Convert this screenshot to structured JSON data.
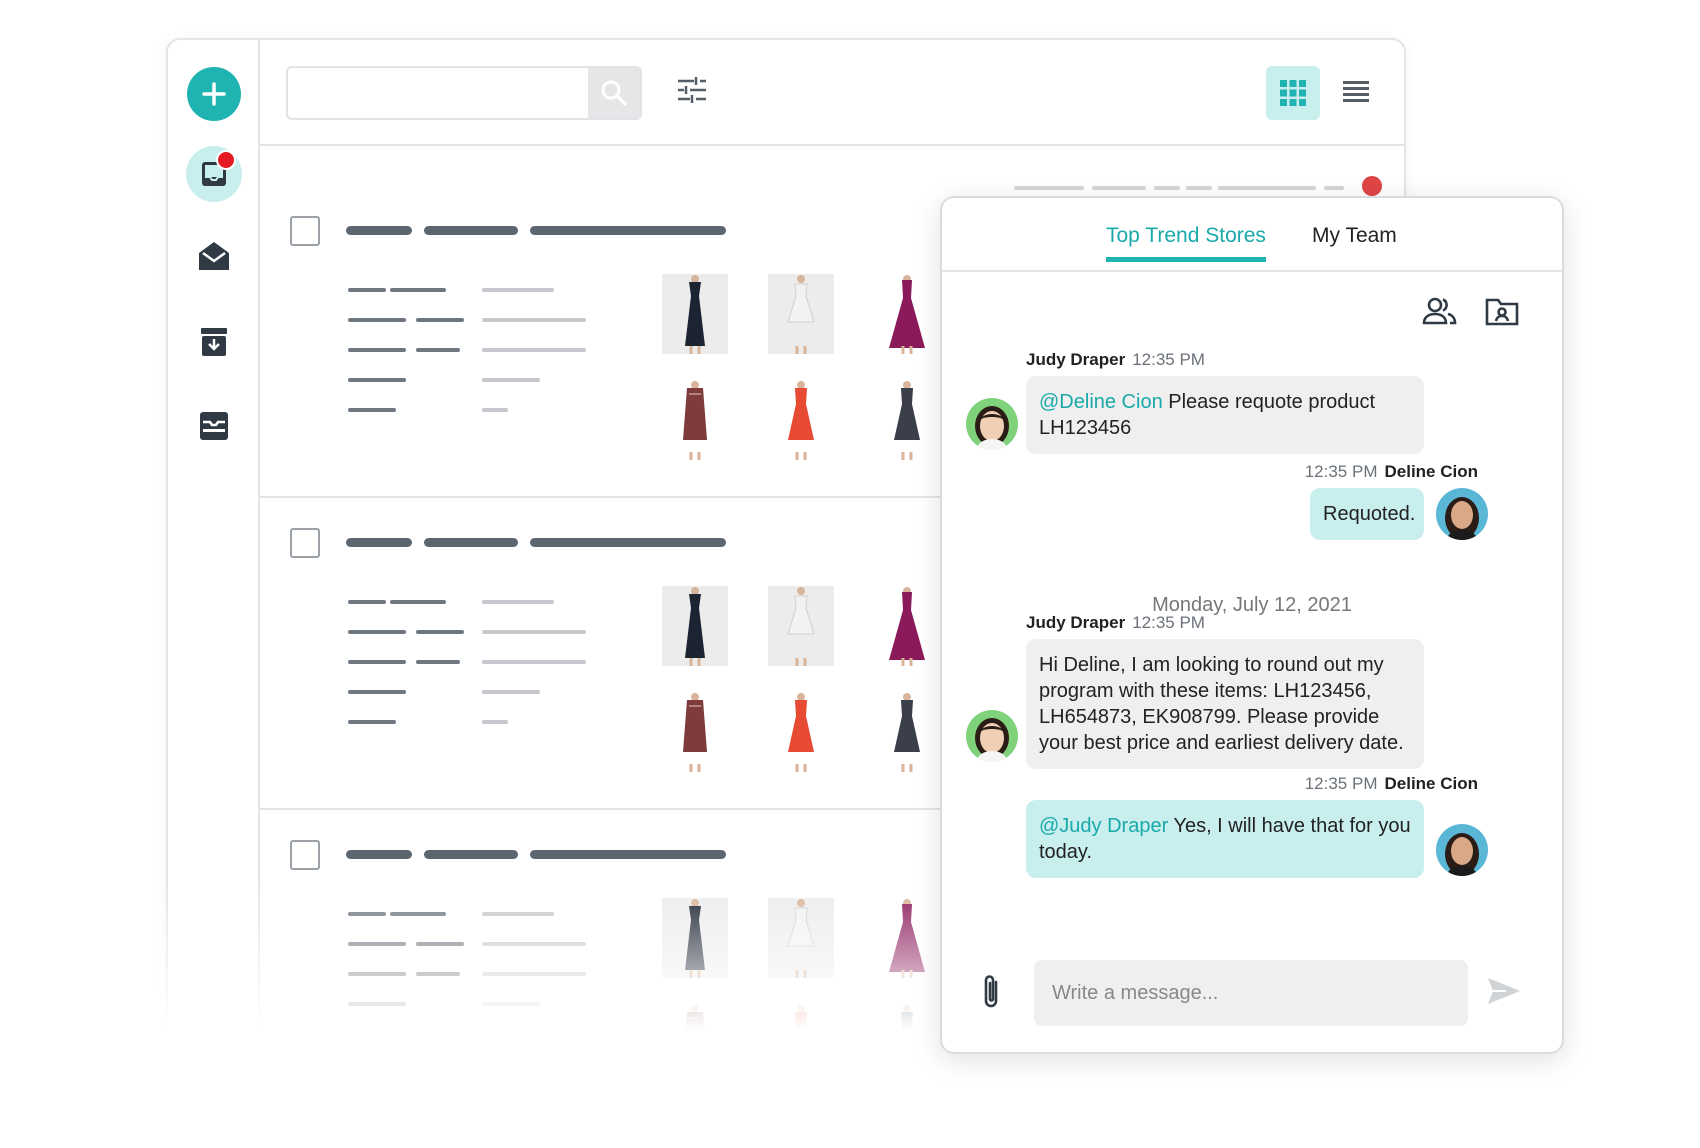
{
  "search": {
    "placeholder": ""
  },
  "colors": {
    "accent": "#1fb3b1",
    "accent_light": "#c9eeee",
    "notification": "#e31b23",
    "bar": "#5c6670"
  },
  "rail": {
    "items": [
      {
        "icon": "add-icon"
      },
      {
        "icon": "inbox-icon",
        "active": true,
        "has_notification": true
      },
      {
        "icon": "open-mail-icon"
      },
      {
        "icon": "archive-icon"
      },
      {
        "icon": "tray-icon"
      }
    ]
  },
  "toolbar": {
    "filter_icon": "sliders-icon",
    "grid_icon": "grid-view-icon",
    "list_icon": "list-view-icon"
  },
  "chat": {
    "tabs": [
      {
        "label": "Top Trend Stores",
        "active": true
      },
      {
        "label": "My Team",
        "active": false
      }
    ],
    "tools": {
      "members_icon": "people-icon",
      "files_icon": "contact-folder-icon"
    },
    "messages": [
      {
        "sender": "Judy Draper",
        "time": "12:35 PM",
        "direction": "in",
        "mention": "@Deline Cion",
        "text": " Please requote product LH123456"
      },
      {
        "sender": "Deline Cion",
        "time": "12:35 PM",
        "direction": "out",
        "mention": "",
        "text": "Requoted."
      },
      {
        "sender": "Judy Draper",
        "time": "12:35 PM",
        "direction": "in",
        "mention": "",
        "text": "Hi Deline, I am looking to round out my program with these items: LH123456, LH654873, EK908799. Please provide your best price and earliest delivery date."
      },
      {
        "sender": "Deline Cion",
        "time": "12:35 PM",
        "direction": "out",
        "mention": "@Judy Draper",
        "text": " Yes, I will have that for you today."
      }
    ],
    "date_separator": "Monday, July 12, 2021",
    "composer": {
      "placeholder": "Write a message..."
    }
  }
}
